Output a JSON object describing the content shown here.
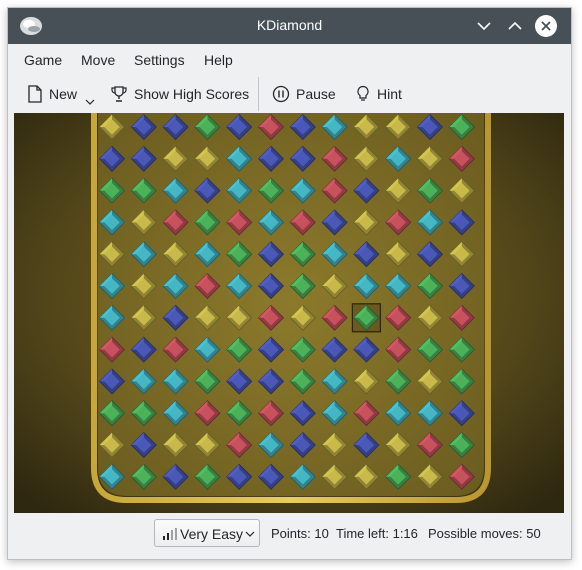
{
  "window": {
    "title": "KDiamond"
  },
  "menu": [
    "Game",
    "Move",
    "Settings",
    "Help"
  ],
  "toolbar": {
    "new_label": "New",
    "high_scores_label": "Show High Scores",
    "pause_label": "Pause",
    "hint_label": "Hint"
  },
  "board": {
    "selected": {
      "row": 6,
      "col": 8
    },
    "gem_colors": {
      "Y": "#c9b94a",
      "B": "#4a58b8",
      "G": "#4cb25a",
      "R": "#c8515e",
      "C": "#44b6c4"
    },
    "grid": [
      [
        "Y",
        "B",
        "B",
        "G",
        "B",
        "R",
        "B",
        "C",
        "Y",
        "Y",
        "B",
        "G"
      ],
      [
        "B",
        "B",
        "Y",
        "Y",
        "C",
        "B",
        "B",
        "R",
        "Y",
        "C",
        "Y",
        "R"
      ],
      [
        "G",
        "G",
        "C",
        "B",
        "C",
        "G",
        "C",
        "R",
        "B",
        "Y",
        "G",
        "Y"
      ],
      [
        "C",
        "Y",
        "R",
        "G",
        "R",
        "C",
        "R",
        "B",
        "Y",
        "R",
        "C",
        "B"
      ],
      [
        "Y",
        "C",
        "Y",
        "C",
        "G",
        "B",
        "G",
        "C",
        "B",
        "Y",
        "B",
        "Y"
      ],
      [
        "C",
        "Y",
        "C",
        "R",
        "C",
        "B",
        "G",
        "Y",
        "C",
        "C",
        "G",
        "B"
      ],
      [
        "C",
        "Y",
        "B",
        "Y",
        "Y",
        "R",
        "Y",
        "R",
        "G",
        "R",
        "Y",
        "R"
      ],
      [
        "R",
        "B",
        "R",
        "C",
        "G",
        "B",
        "G",
        "B",
        "B",
        "R",
        "G",
        "G"
      ],
      [
        "B",
        "C",
        "C",
        "G",
        "B",
        "B",
        "G",
        "C",
        "Y",
        "G",
        "Y",
        "G"
      ],
      [
        "G",
        "G",
        "C",
        "R",
        "G",
        "R",
        "B",
        "C",
        "R",
        "C",
        "C",
        "B"
      ],
      [
        "Y",
        "B",
        "Y",
        "Y",
        "R",
        "C",
        "B",
        "Y",
        "B",
        "Y",
        "R",
        "G"
      ],
      [
        "C",
        "G",
        "B",
        "G",
        "B",
        "B",
        "C",
        "Y",
        "Y",
        "G",
        "Y",
        "R"
      ]
    ]
  },
  "status": {
    "difficulty": "Very Easy",
    "points": "Points: 10",
    "time_left": "Time left: 1:16",
    "possible_moves": "Possible moves: 50"
  }
}
